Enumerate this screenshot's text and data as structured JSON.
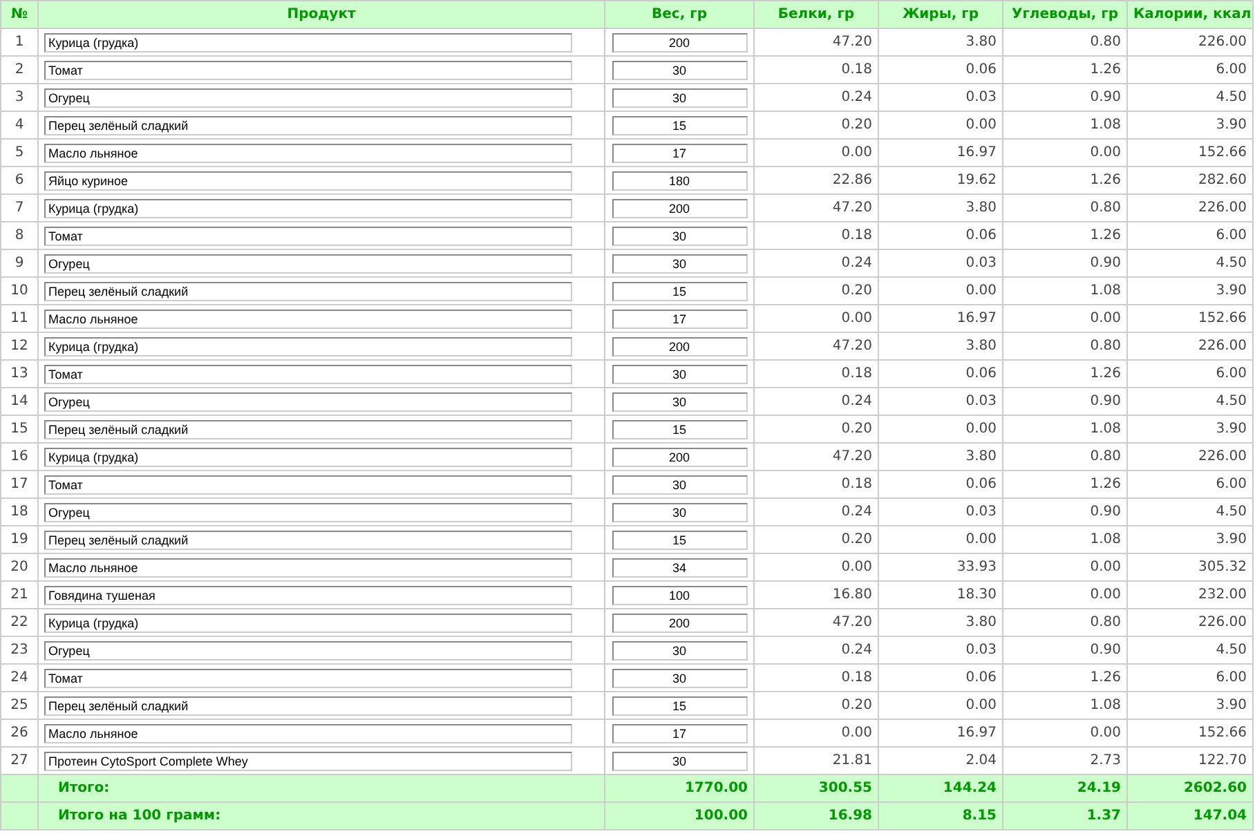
{
  "table": {
    "columns": [
      "№",
      "Продукт",
      "Вес, гр",
      "Белки, гр",
      "Жиры, гр",
      "Углеводы, гр",
      "Калории, ккал"
    ],
    "rows": [
      {
        "number": "1",
        "product": "Курица (грудка)",
        "weight": "200",
        "protein": "47.20",
        "fat": "3.80",
        "carbs": "0.80",
        "calories": "226.00"
      },
      {
        "number": "2",
        "product": "Томат",
        "weight": "30",
        "protein": "0.18",
        "fat": "0.06",
        "carbs": "1.26",
        "calories": "6.00"
      },
      {
        "number": "3",
        "product": "Огурец",
        "weight": "30",
        "protein": "0.24",
        "fat": "0.03",
        "carbs": "0.90",
        "calories": "4.50"
      },
      {
        "number": "4",
        "product": "Перец зелёный сладкий",
        "weight": "15",
        "protein": "0.20",
        "fat": "0.00",
        "carbs": "1.08",
        "calories": "3.90"
      },
      {
        "number": "5",
        "product": "Масло льняное",
        "weight": "17",
        "protein": "0.00",
        "fat": "16.97",
        "carbs": "0.00",
        "calories": "152.66"
      },
      {
        "number": "6",
        "product": "Яйцо куриное",
        "weight": "180",
        "protein": "22.86",
        "fat": "19.62",
        "carbs": "1.26",
        "calories": "282.60"
      },
      {
        "number": "7",
        "product": "Курица (грудка)",
        "weight": "200",
        "protein": "47.20",
        "fat": "3.80",
        "carbs": "0.80",
        "calories": "226.00"
      },
      {
        "number": "8",
        "product": "Томат",
        "weight": "30",
        "protein": "0.18",
        "fat": "0.06",
        "carbs": "1.26",
        "calories": "6.00"
      },
      {
        "number": "9",
        "product": "Огурец",
        "weight": "30",
        "protein": "0.24",
        "fat": "0.03",
        "carbs": "0.90",
        "calories": "4.50"
      },
      {
        "number": "10",
        "product": "Перец зелёный сладкий",
        "weight": "15",
        "protein": "0.20",
        "fat": "0.00",
        "carbs": "1.08",
        "calories": "3.90"
      },
      {
        "number": "11",
        "product": "Масло льняное",
        "weight": "17",
        "protein": "0.00",
        "fat": "16.97",
        "carbs": "0.00",
        "calories": "152.66"
      },
      {
        "number": "12",
        "product": "Курица (грудка)",
        "weight": "200",
        "protein": "47.20",
        "fat": "3.80",
        "carbs": "0.80",
        "calories": "226.00"
      },
      {
        "number": "13",
        "product": "Томат",
        "weight": "30",
        "protein": "0.18",
        "fat": "0.06",
        "carbs": "1.26",
        "calories": "6.00"
      },
      {
        "number": "14",
        "product": "Огурец",
        "weight": "30",
        "protein": "0.24",
        "fat": "0.03",
        "carbs": "0.90",
        "calories": "4.50"
      },
      {
        "number": "15",
        "product": "Перец зелёный сладкий",
        "weight": "15",
        "protein": "0.20",
        "fat": "0.00",
        "carbs": "1.08",
        "calories": "3.90"
      },
      {
        "number": "16",
        "product": "Курица (грудка)",
        "weight": "200",
        "protein": "47.20",
        "fat": "3.80",
        "carbs": "0.80",
        "calories": "226.00"
      },
      {
        "number": "17",
        "product": "Томат",
        "weight": "30",
        "protein": "0.18",
        "fat": "0.06",
        "carbs": "1.26",
        "calories": "6.00"
      },
      {
        "number": "18",
        "product": "Огурец",
        "weight": "30",
        "protein": "0.24",
        "fat": "0.03",
        "carbs": "0.90",
        "calories": "4.50"
      },
      {
        "number": "19",
        "product": "Перец зелёный сладкий",
        "weight": "15",
        "protein": "0.20",
        "fat": "0.00",
        "carbs": "1.08",
        "calories": "3.90"
      },
      {
        "number": "20",
        "product": "Масло льняное",
        "weight": "34",
        "protein": "0.00",
        "fat": "33.93",
        "carbs": "0.00",
        "calories": "305.32"
      },
      {
        "number": "21",
        "product": "Говядина тушеная",
        "weight": "100",
        "protein": "16.80",
        "fat": "18.30",
        "carbs": "0.00",
        "calories": "232.00"
      },
      {
        "number": "22",
        "product": "Курица (грудка)",
        "weight": "200",
        "protein": "47.20",
        "fat": "3.80",
        "carbs": "0.80",
        "calories": "226.00"
      },
      {
        "number": "23",
        "product": "Огурец",
        "weight": "30",
        "protein": "0.24",
        "fat": "0.03",
        "carbs": "0.90",
        "calories": "4.50"
      },
      {
        "number": "24",
        "product": "Томат",
        "weight": "30",
        "protein": "0.18",
        "fat": "0.06",
        "carbs": "1.26",
        "calories": "6.00"
      },
      {
        "number": "25",
        "product": "Перец зелёный сладкий",
        "weight": "15",
        "protein": "0.20",
        "fat": "0.00",
        "carbs": "1.08",
        "calories": "3.90"
      },
      {
        "number": "26",
        "product": "Масло льняное",
        "weight": "17",
        "protein": "0.00",
        "fat": "16.97",
        "carbs": "0.00",
        "calories": "152.66"
      },
      {
        "number": "27",
        "product": "Протеин CytoSport Complete Whey",
        "weight": "30",
        "protein": "21.81",
        "fat": "2.04",
        "carbs": "2.73",
        "calories": "122.70"
      }
    ],
    "totals": [
      {
        "label": "Итого:",
        "weight": "1770.00",
        "protein": "300.55",
        "fat": "144.24",
        "carbs": "24.19",
        "calories": "2602.60"
      },
      {
        "label": "Итого на 100 грамм:",
        "weight": "100.00",
        "protein": "16.98",
        "fat": "8.15",
        "carbs": "1.37",
        "calories": "147.04"
      }
    ]
  }
}
